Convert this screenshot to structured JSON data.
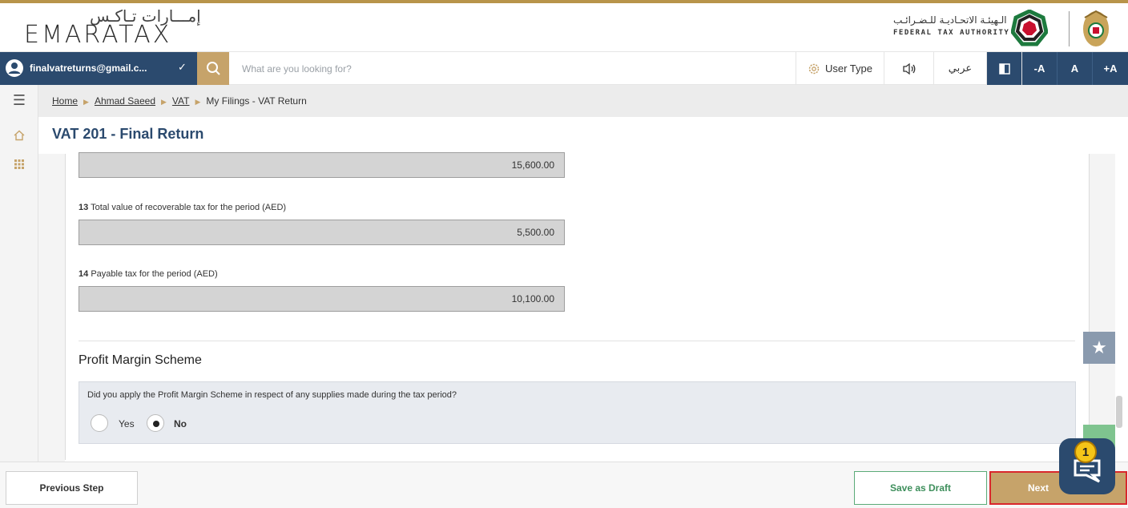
{
  "header": {
    "logo_arabic": "إمـــارات تـاكـس",
    "logo_english": "EMARATAX",
    "authority_arabic": "الـهيئـة الاتحـاديـة للـضـرائـب",
    "authority_english": "FEDERAL TAX AUTHORITY"
  },
  "topbar": {
    "user_email": "finalvatreturns@gmail.c...",
    "search_placeholder": "What are you looking for?",
    "user_type_label": "User Type",
    "arabic_toggle": "عربي",
    "font_decrease": "-A",
    "font_default": "A",
    "font_increase": "+A"
  },
  "breadcrumb": {
    "items": [
      "Home",
      "Ahmad Saeed",
      "VAT"
    ],
    "current": "My Filings - VAT Return"
  },
  "page": {
    "title": "VAT 201 - Final Return"
  },
  "fields": [
    {
      "number": "",
      "label": "",
      "value": "15,600.00"
    },
    {
      "number": "13",
      "label": "Total value of recoverable tax for the period (AED)",
      "value": "5,500.00"
    },
    {
      "number": "14",
      "label": "Payable tax for the period (AED)",
      "value": "10,100.00"
    }
  ],
  "profit_margin": {
    "section_title": "Profit Margin Scheme",
    "question": "Did you apply the Profit Margin Scheme in respect of any supplies made during the tax period?",
    "options": [
      "Yes",
      "No"
    ],
    "selected": "No"
  },
  "footer": {
    "previous_label": "Previous Step",
    "draft_label": "Save as Draft",
    "next_label": "Next"
  },
  "chat": {
    "badge_count": "1"
  },
  "colors": {
    "navy": "#2b4a6e",
    "gold": "#c6a36a",
    "green": "#3e8f5c",
    "highlight_red": "#d9272d"
  },
  "icons": {
    "user": "user-avatar-icon",
    "search": "search-icon",
    "settings": "gear-icon",
    "speaker": "speaker-icon",
    "contrast": "contrast-icon",
    "menu": "hamburger-icon",
    "home": "home-icon",
    "apps": "grid-icon",
    "star": "star-icon",
    "chat": "chat-icon"
  }
}
